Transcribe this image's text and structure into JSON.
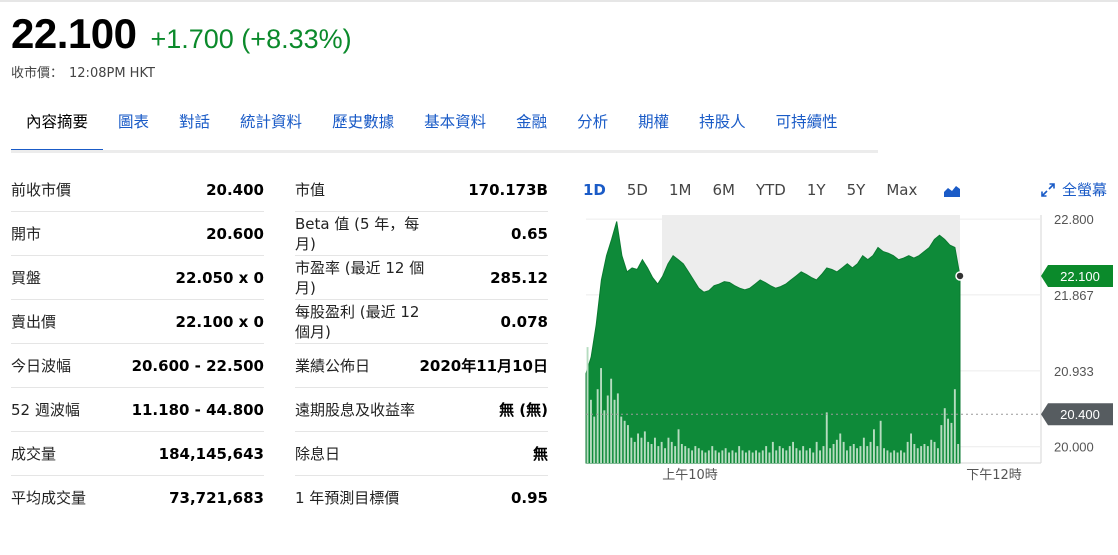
{
  "quote": {
    "price": "22.100",
    "change": "+1.700 (+8.33%)",
    "close_label": "收市價：",
    "close_time": "12:08PM HKT"
  },
  "tabs": [
    "內容摘要",
    "圖表",
    "對話",
    "統計資料",
    "歷史數據",
    "基本資料",
    "金融",
    "分析",
    "期權",
    "持股人",
    "可持續性"
  ],
  "stats_left": [
    {
      "label": "前收市價",
      "value": "20.400"
    },
    {
      "label": "開市",
      "value": "20.600"
    },
    {
      "label": "買盤",
      "value": "22.050 x 0"
    },
    {
      "label": "賣出價",
      "value": "22.100 x 0"
    },
    {
      "label": "今日波幅",
      "value": "20.600 - 22.500"
    },
    {
      "label": "52 週波幅",
      "value": "11.180 - 44.800"
    },
    {
      "label": "成交量",
      "value": "184,145,643"
    },
    {
      "label": "平均成交量",
      "value": "73,721,683"
    }
  ],
  "stats_right": [
    {
      "label": "市值",
      "value": "170.173B"
    },
    {
      "label": "Beta 值 (5 年，每月)",
      "value": "0.65"
    },
    {
      "label": "市盈率 (最近 12 個月)",
      "value": "285.12"
    },
    {
      "label": "每股盈利 (最近 12 個月)",
      "value": "0.078"
    },
    {
      "label": "業績公佈日",
      "value": "2020年11月10日"
    },
    {
      "label": "遠期股息及收益率",
      "value": "無 (無)"
    },
    {
      "label": "除息日",
      "value": "無"
    },
    {
      "label": "1 年預測目標價",
      "value": "0.95"
    }
  ],
  "ranges": [
    "1D",
    "5D",
    "1M",
    "6M",
    "YTD",
    "1Y",
    "5Y",
    "Max"
  ],
  "active_range": "1D",
  "fullscreen_label": "全螢幕",
  "colors": {
    "up": "#0b8a2b",
    "area": "#0e8a39",
    "link": "#1a5bc7",
    "marker_dark": "#565c60",
    "volume": "#b6dcc0"
  },
  "chart_data": {
    "type": "area",
    "x_ticks": [
      "上午10時",
      "下午12時"
    ],
    "y_ticks": [
      "22.800",
      "21.867",
      "20.933",
      "20.000"
    ],
    "ylim": [
      19.8,
      22.85
    ],
    "last_price": "22.100",
    "prev_close": "20.400",
    "values": [
      20.9,
      21.1,
      21.5,
      22.05,
      22.35,
      22.55,
      22.77,
      22.35,
      22.15,
      22.2,
      22.18,
      22.3,
      22.2,
      22.08,
      22.0,
      22.1,
      22.25,
      22.35,
      22.3,
      22.25,
      22.15,
      22.05,
      21.95,
      21.9,
      21.92,
      21.98,
      22.0,
      22.03,
      22.02,
      21.98,
      21.95,
      21.93,
      21.95,
      22.0,
      22.05,
      22.02,
      21.98,
      21.95,
      21.97,
      22.0,
      22.05,
      22.1,
      22.15,
      22.12,
      22.08,
      22.05,
      22.12,
      22.2,
      22.18,
      22.15,
      22.2,
      22.25,
      22.2,
      22.25,
      22.35,
      22.3,
      22.35,
      22.45,
      22.4,
      22.38,
      22.35,
      22.3,
      22.32,
      22.35,
      22.32,
      22.35,
      22.4,
      22.45,
      22.55,
      22.6,
      22.55,
      22.48,
      22.45,
      22.1
    ],
    "volume": [
      0.55,
      0.3,
      0.22,
      0.35,
      0.45,
      0.25,
      0.32,
      0.4,
      0.3,
      0.33,
      0.22,
      0.2,
      0.18,
      0.12,
      0.1,
      0.14,
      0.12,
      0.15,
      0.1,
      0.09,
      0.12,
      0.08,
      0.1,
      0.07,
      0.12,
      0.1,
      0.08,
      0.16,
      0.09,
      0.08,
      0.07,
      0.06,
      0.08,
      0.07,
      0.06,
      0.05,
      0.06,
      0.08,
      0.06,
      0.05,
      0.06,
      0.07,
      0.05,
      0.06,
      0.05,
      0.08,
      0.06,
      0.05,
      0.06,
      0.05,
      0.06,
      0.05,
      0.06,
      0.08,
      0.05,
      0.1,
      0.06,
      0.08,
      0.07,
      0.06,
      0.08,
      0.1,
      0.07,
      0.06,
      0.08,
      0.06,
      0.07,
      0.05,
      0.1,
      0.06,
      0.08,
      0.24,
      0.07,
      0.09,
      0.11,
      0.14,
      0.1,
      0.06,
      0.08,
      0.09,
      0.07,
      0.08,
      0.12,
      0.08,
      0.1,
      0.16,
      0.08,
      0.2,
      0.07,
      0.06,
      0.05,
      0.06,
      0.05,
      0.06,
      0.05,
      0.1,
      0.14,
      0.09,
      0.07,
      0.08,
      0.09,
      0.08,
      0.11,
      0.1,
      0.07,
      0.18,
      0.26,
      0.21,
      0.19,
      0.35,
      0.09
    ]
  }
}
